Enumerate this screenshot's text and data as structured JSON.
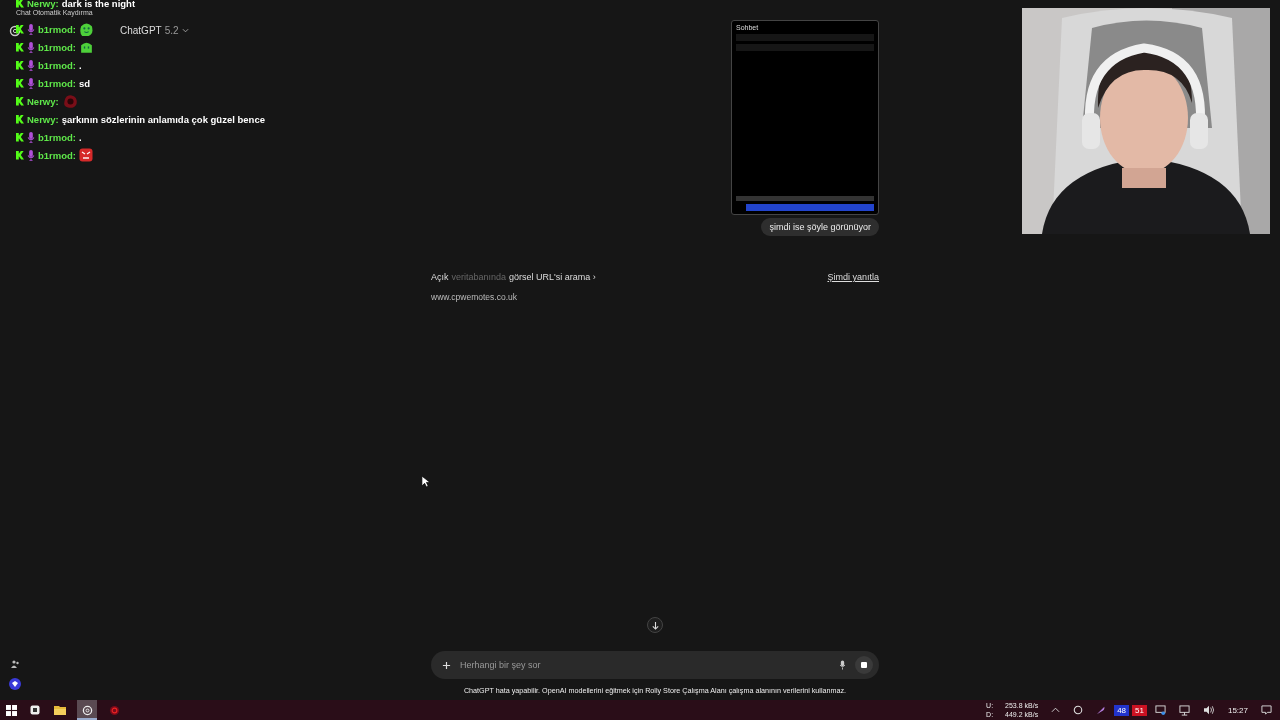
{
  "chat_overlay": {
    "title": "Chat Otomatik Kaydırma",
    "messages": [
      {
        "user": "Nerwy:",
        "mic_badge": false,
        "kind": "text",
        "text": "dark is the night"
      },
      {
        "user": "b1rmod:",
        "mic_badge": true,
        "kind": "blob"
      },
      {
        "user": "b1rmod:",
        "mic_badge": true,
        "kind": "slime"
      },
      {
        "user": "b1rmod:",
        "mic_badge": true,
        "kind": "text",
        "text": "."
      },
      {
        "user": "b1rmod:",
        "mic_badge": true,
        "kind": "text",
        "text": "sd"
      },
      {
        "user": "Nerwy:",
        "mic_badge": false,
        "kind": "shadow"
      },
      {
        "user": "Nerwy:",
        "mic_badge": false,
        "kind": "text",
        "text": "şarkının sözlerinin anlamıda çok güzel bence"
      },
      {
        "user": "b1rmod:",
        "mic_badge": true,
        "kind": "text",
        "text": "."
      },
      {
        "user": "b1rmod:",
        "mic_badge": true,
        "kind": "angry"
      }
    ]
  },
  "header": {
    "model": "ChatGPT",
    "version": "5.2"
  },
  "conversation": {
    "attachment": {
      "kind": "screenshot",
      "title": "Sohbet"
    },
    "user_message": "şimdi ise şöyle görünüyor",
    "status_parts": [
      {
        "text": "Açık",
        "dim": false
      },
      {
        "text": "veritabanında",
        "dim": true
      },
      {
        "text": "görsel URL'si arama ›",
        "dim": false
      }
    ],
    "reply_link": "Şimdi yanıtla",
    "source": "www.cpwemotes.co.uk"
  },
  "composer": {
    "placeholder": "Herhangi bir şey sor",
    "generating": true
  },
  "disclaimer": "ChatGPT hata yapabilir. OpenAI modellerini eğitmek için Rolly Store Çalışma Alanı çalışma alanının verilerini kullanmaz.",
  "taskbar": {
    "apps": [
      {
        "kind": "explorer",
        "selected": false
      },
      {
        "kind": "chatgpt",
        "selected": true
      },
      {
        "kind": "recorder",
        "selected": false
      }
    ],
    "upload_label": "U:",
    "upload_rate": "253.8 kB/s",
    "download_label": "D:",
    "download_rate": "449.2 kB/s",
    "badges": [
      {
        "text": "48",
        "color": "#2233cc"
      },
      {
        "text": "51",
        "color": "#cc1122"
      }
    ],
    "time": "15:27"
  }
}
